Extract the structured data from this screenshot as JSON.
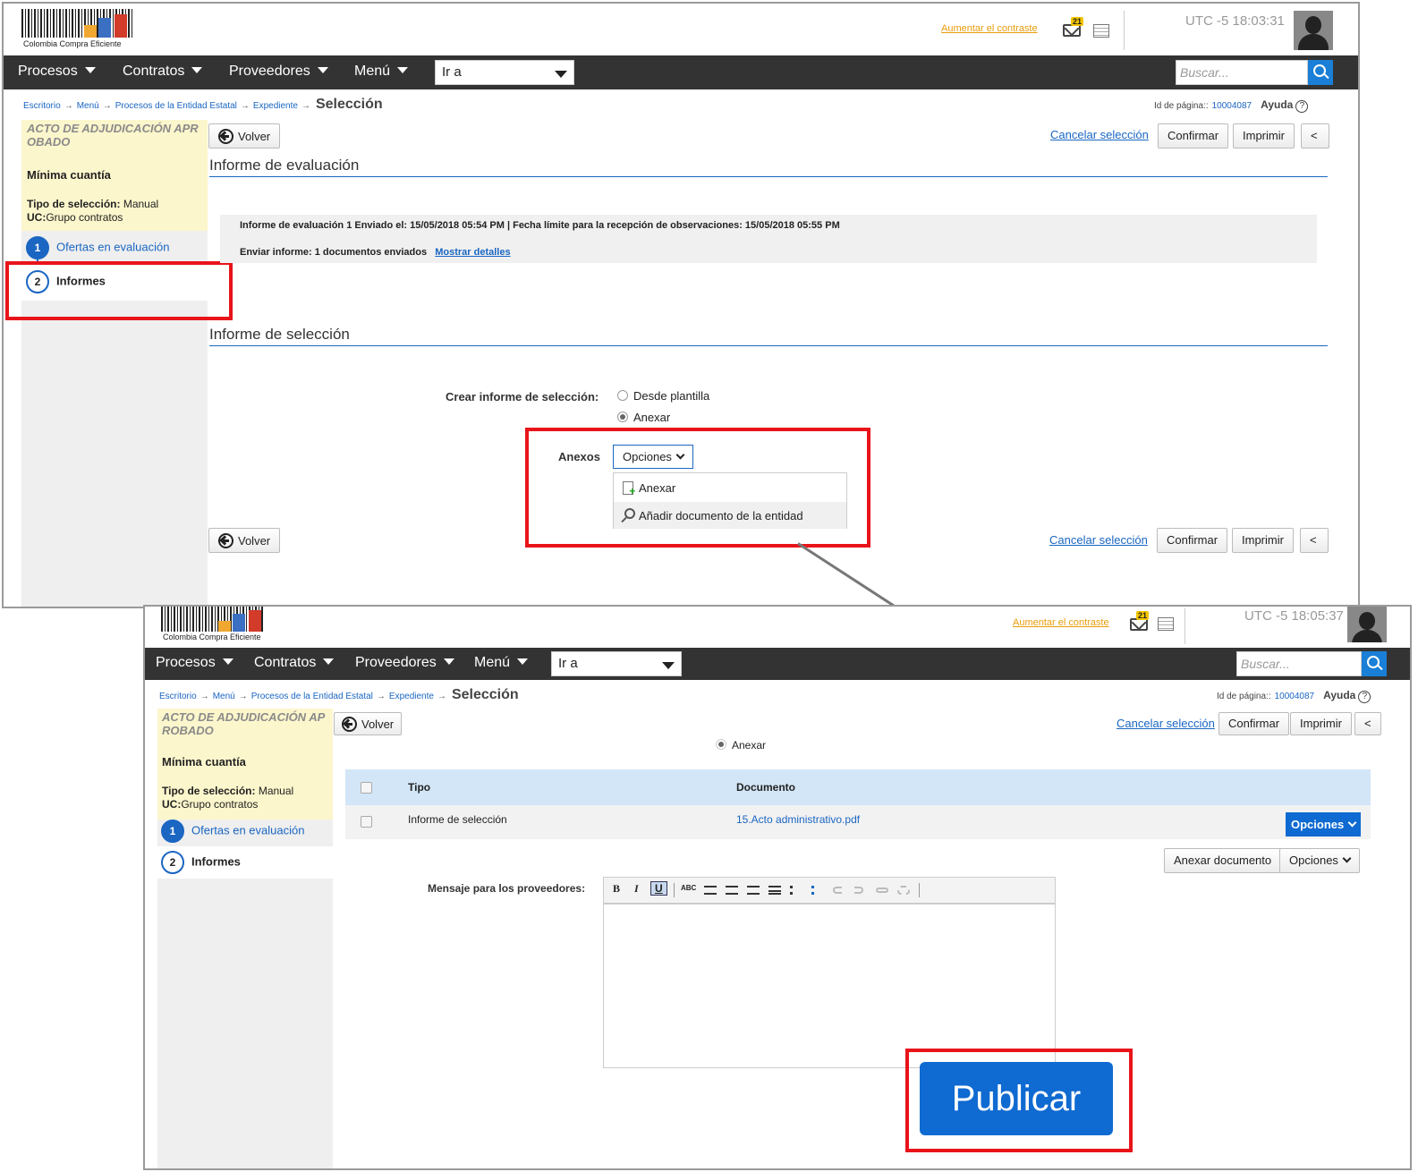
{
  "logo_text": "Colombia Compra Eficiente",
  "header": {
    "contrast_link": "Aumentar el contraste",
    "mail_count": "21",
    "utc1": "UTC -5 18:03:31",
    "utc2": "UTC -5 18:05:37"
  },
  "nav": {
    "items": [
      "Procesos",
      "Contratos",
      "Proveedores",
      "Menú"
    ],
    "goto": "Ir a",
    "search_placeholder": "Buscar..."
  },
  "breadcrumb": {
    "items": [
      "Escritorio",
      "Menú",
      "Procesos de la Entidad Estatal",
      "Expediente"
    ],
    "current": "Selección",
    "arrow": "→"
  },
  "page_id": {
    "label": "Id de página::",
    "value": "10004087",
    "help": "Ayuda",
    "qm": "?"
  },
  "summary": {
    "title": "ACTO DE ADJUDICACIÓN APROBADO",
    "modality": "Mínima cuantía",
    "type_label": "Tipo de selección:",
    "type_value": "Manual",
    "uc_label": "UC:",
    "uc_value": "Grupo contratos"
  },
  "steps": [
    {
      "n": "1",
      "label": "Ofertas en evaluación"
    },
    {
      "n": "2",
      "label": "Informes"
    }
  ],
  "buttons": {
    "back": "Volver",
    "cancel": "Cancelar selección",
    "confirm": "Confirmar",
    "print": "Imprimir",
    "collapse": "<"
  },
  "s1": {
    "eval_title": "Informe de evaluación",
    "eval_line1": "Informe de evaluación 1  Enviado el: 15/05/2018 05:54 PM | Fecha límite para la recepción de observaciones: 15/05/2018 05:55 PM",
    "eval_line2_label": "Enviar informe:",
    "eval_line2_value": "1 documentos enviados",
    "show_details": "Mostrar detalles",
    "sel_title": "Informe de selección",
    "create_label": "Crear informe de selección:",
    "opt_template": "Desde plantilla",
    "opt_attach": "Anexar",
    "anexos_label": "Anexos",
    "options_btn": "Opciones",
    "menu": [
      "Anexar",
      "Añadir documento de la entidad"
    ]
  },
  "s2": {
    "radio": "Anexar",
    "table": {
      "headers": [
        "Tipo",
        "Documento"
      ],
      "rows": [
        {
          "tipo": "Informe de selección",
          "documento": "15.Acto administrativo.pdf",
          "action": "Opciones"
        }
      ]
    },
    "attach_btn": "Anexar documento",
    "options_btn": "Opciones",
    "message_label": "Mensaje para los proveedores:",
    "toolbar": {
      "bold": "B",
      "italic": "I",
      "underline": "U",
      "spell": "ABC"
    },
    "publish": "Publicar"
  },
  "colors": {
    "accent": "#1a66c2",
    "highlight": "#e8141a",
    "nav": "#333333",
    "publish": "#0f6ad1"
  }
}
